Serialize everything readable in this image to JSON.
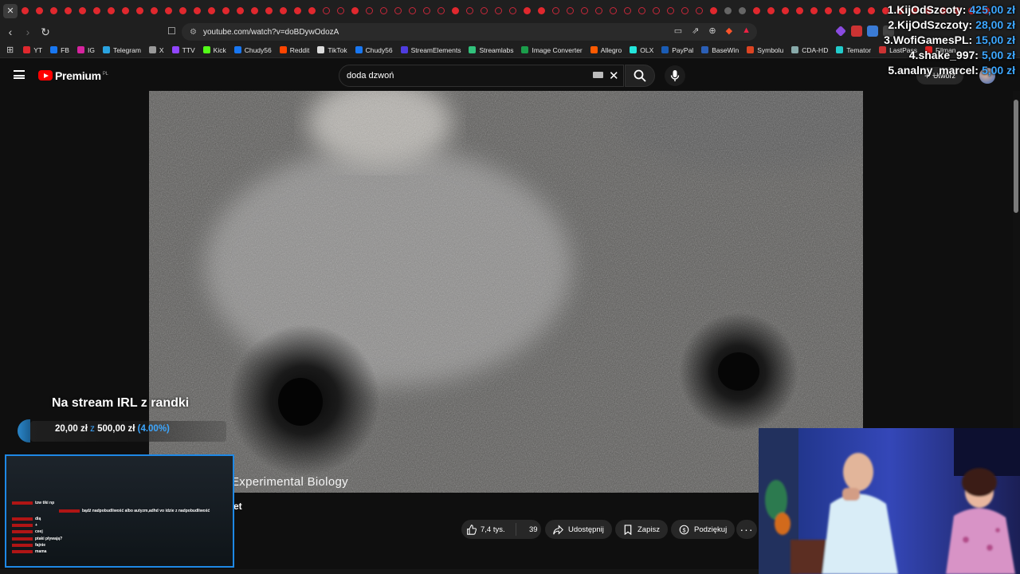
{
  "browser": {
    "url": "youtube.com/watch?v=doBDywOdozA",
    "bookmarks": [
      "YT",
      "FB",
      "IG",
      "Telegram",
      "X",
      "TTV",
      "Kick",
      "Chudy56",
      "Reddit",
      "TikTok",
      "Chudy56",
      "StreamElements",
      "Streamlabs",
      "Image Converter",
      "Allegro",
      "OLX",
      "PayPal",
      "BaseWin",
      "Symbolu",
      "CDA-HD",
      "Temator",
      "LastPass",
      "Filman"
    ]
  },
  "youtube": {
    "brand": "Premium",
    "brand_region": "PL",
    "search_value": "doda dzwoń",
    "create_label": "Utwórz"
  },
  "video": {
    "caption": "Experimental Biology",
    "channel_fragment": "et",
    "likes": "7,4 tys.",
    "comments": "39",
    "share_label": "Udostępnij",
    "save_label": "Zapisz",
    "thanks_label": "Podziękuj"
  },
  "overlay": {
    "leaderboard": [
      {
        "rank": "1.",
        "name": "KijOdSzcoty:",
        "amount": "425,00 zł"
      },
      {
        "rank": "2.",
        "name": "KijOdSzczoty:",
        "amount": "28,00 zł"
      },
      {
        "rank": "3.",
        "name": "WofiGamesPL:",
        "amount": "15,00 zł"
      },
      {
        "rank": "4.",
        "name": "shake_997:",
        "amount": "5,00 zł"
      },
      {
        "rank": "5.",
        "name": "analny_marcel:",
        "amount": "5,00 zł"
      }
    ],
    "goal": {
      "title": "Na stream IRL z randki",
      "current": "20,00 zł",
      "sep": "z",
      "target": "500,00 zł",
      "percent": "(4.00%)",
      "progress": 0.04
    },
    "chat": [
      {
        "user": "",
        "text": "tzw tiki np"
      },
      {
        "user": "",
        "text": "bądź nadpobudliwość albo autyzm,adhd vo idzie z nadpobudliwość"
      },
      {
        "user": "",
        "text": "dią"
      },
      {
        "user": "",
        "text": "+"
      },
      {
        "user": "",
        "text": "ceej"
      },
      {
        "user": "",
        "text": "ptaki pływają?"
      },
      {
        "user": "",
        "text": "fajnie"
      },
      {
        "user": "",
        "text": "mama"
      }
    ]
  },
  "colors": {
    "accent": "#3da7ff",
    "youtube_red": "#ff0000",
    "chat_border": "#1e88e5"
  }
}
